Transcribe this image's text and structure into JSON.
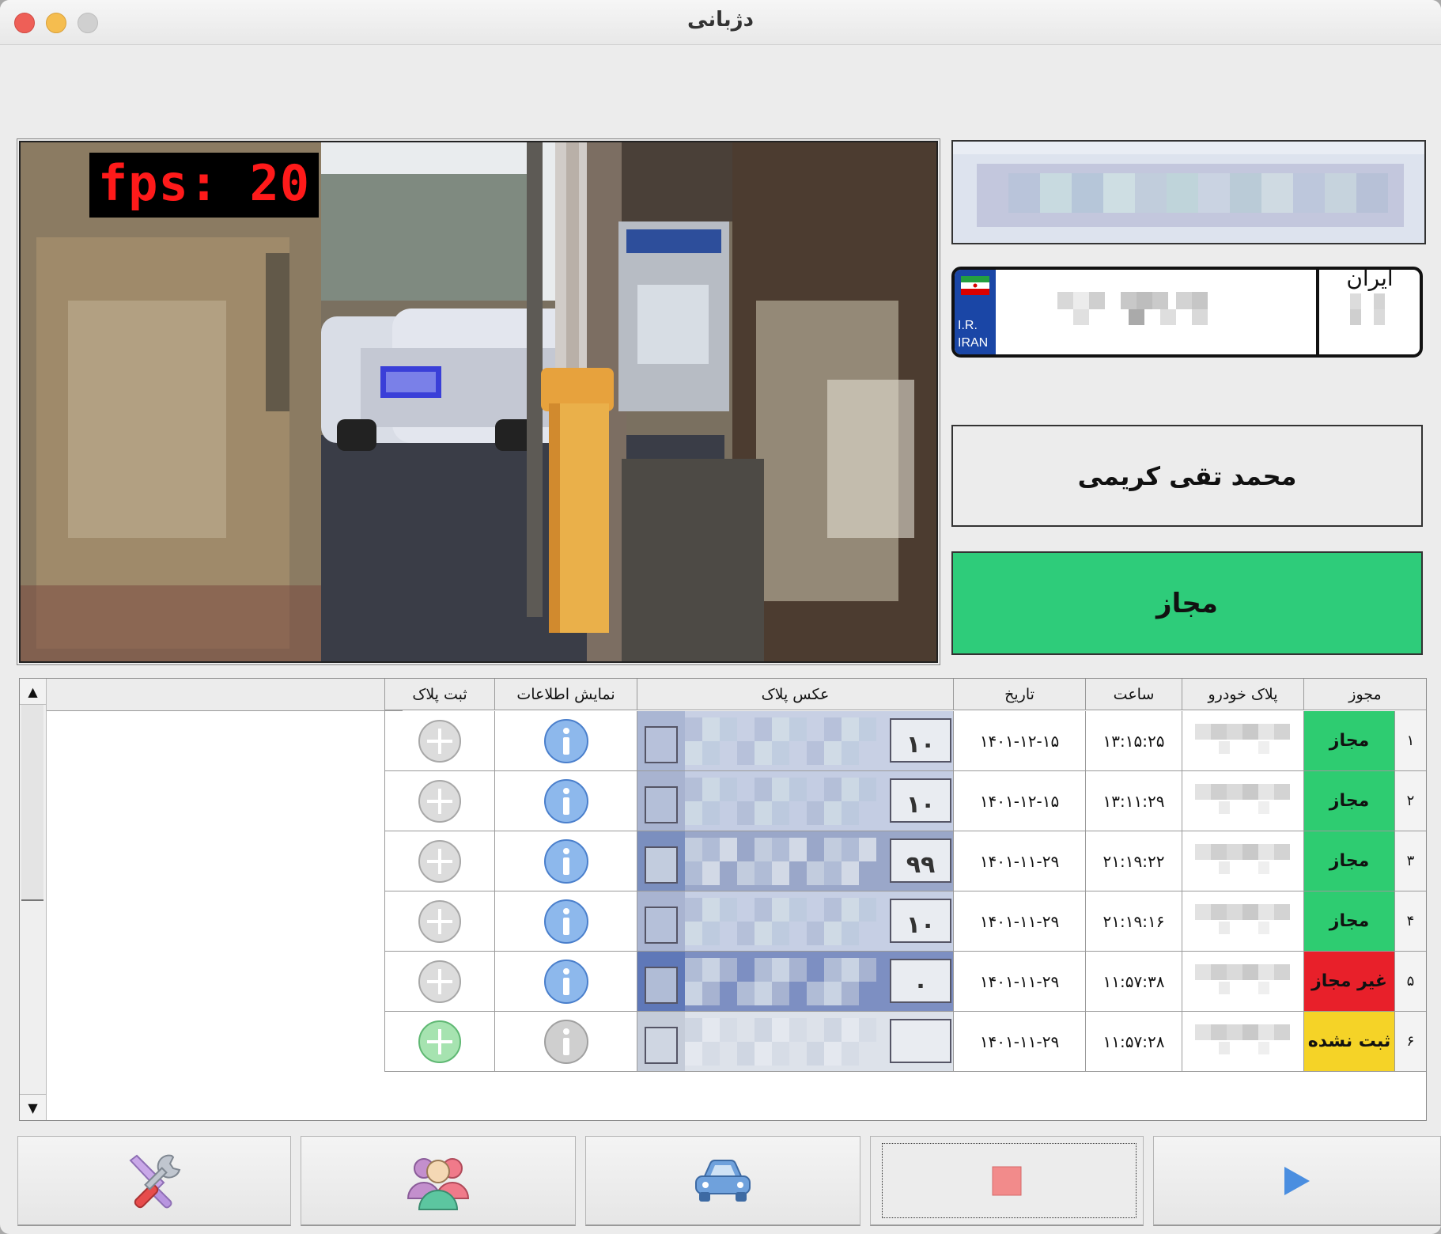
{
  "window": {
    "title": "دژبانی"
  },
  "camera": {
    "fps_label": "fps: 20"
  },
  "plate_panel": {
    "country_text": "ایران",
    "ir_line1": "I.R.",
    "ir_line2": "IRAN"
  },
  "owner": {
    "name": "محمد تقی کریمی"
  },
  "current_status": {
    "label": "مجاز",
    "color": "#2ecc7a"
  },
  "table": {
    "headers": {
      "permit": "مجوز",
      "plate": "پلاک خودرو",
      "time": "ساعت",
      "date": "تاریخ",
      "plate_photo": "عکس پلاک",
      "show_info": "نمایش اطلاعات",
      "register_plate": "ثبت پلاک"
    },
    "rows": [
      {
        "index": "۱",
        "permit": "مجاز",
        "permit_color": "#2ecc71",
        "time": "۱۳:۱۵:۲۵",
        "date": "۱۴۰۱-۱۲-۱۵",
        "photo_label": "۱۰",
        "info_icon": "info-icon-blue",
        "add_icon": "plus-icon-gray"
      },
      {
        "index": "۲",
        "permit": "مجاز",
        "permit_color": "#2ecc71",
        "time": "۱۳:۱۱:۲۹",
        "date": "۱۴۰۱-۱۲-۱۵",
        "photo_label": "۱۰",
        "info_icon": "info-icon-blue",
        "add_icon": "plus-icon-gray"
      },
      {
        "index": "۳",
        "permit": "مجاز",
        "permit_color": "#2ecc71",
        "time": "۲۱:۱۹:۲۲",
        "date": "۱۴۰۱-۱۱-۲۹",
        "photo_label": "۹۹",
        "info_icon": "info-icon-blue",
        "add_icon": "plus-icon-gray"
      },
      {
        "index": "۴",
        "permit": "مجاز",
        "permit_color": "#2ecc71",
        "time": "۲۱:۱۹:۱۶",
        "date": "۱۴۰۱-۱۱-۲۹",
        "photo_label": "۱۰",
        "info_icon": "info-icon-blue",
        "add_icon": "plus-icon-gray"
      },
      {
        "index": "۵",
        "permit": "غیر مجاز",
        "permit_color": "#e8202a",
        "time": "۱۱:۵۷:۳۸",
        "date": "۱۴۰۱-۱۱-۲۹",
        "photo_label": "۰",
        "info_icon": "info-icon-blue",
        "add_icon": "plus-icon-gray"
      },
      {
        "index": "۶",
        "permit": "ثبت نشده",
        "permit_color": "#f5d327",
        "time": "۱۱:۵۷:۲۸",
        "date": "۱۴۰۱-۱۱-۲۹",
        "photo_label": "",
        "info_icon": "info-icon-gray",
        "add_icon": "plus-icon-green"
      }
    ]
  },
  "toolbar": {
    "buttons": [
      {
        "name": "settings-button",
        "icon": "tools-icon"
      },
      {
        "name": "users-button",
        "icon": "users-icon"
      },
      {
        "name": "vehicles-button",
        "icon": "car-icon"
      },
      {
        "name": "stop-button",
        "icon": "stop-icon"
      },
      {
        "name": "play-button",
        "icon": "play-icon"
      }
    ]
  }
}
